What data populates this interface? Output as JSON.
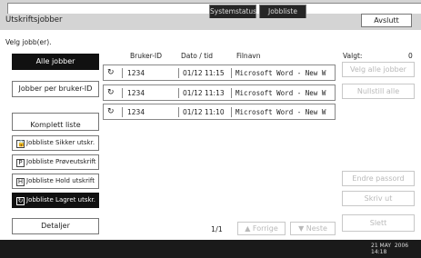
{
  "header": {
    "title": "Utskriftsjobber",
    "exit_label": "Avslutt"
  },
  "prompt": "Velg jobb(er).",
  "left": {
    "all_jobs": "Alle jobber",
    "per_user": "Jobber per bruker-ID",
    "complete_list": "Komplett liste",
    "list_buttons": [
      {
        "icon": "lock-icon",
        "glyph": "🔒",
        "label": "Jobbliste Sikker utskr."
      },
      {
        "icon": "proof-print-icon",
        "glyph": "P",
        "label": "Jobbliste Prøveutskrift"
      },
      {
        "icon": "hold-print-icon",
        "glyph": "H",
        "label": "Jobbliste Hold utskrift"
      },
      {
        "icon": "stored-print-icon",
        "glyph": "↻",
        "label": "Jobbliste Lagret utskr."
      }
    ],
    "details": "Detaljer"
  },
  "table": {
    "columns": [
      "Bruker-ID",
      "Dato / tid",
      "Filnavn"
    ],
    "rows": [
      {
        "user": "1234",
        "datetime": "01/12 11:15",
        "file": "Microsoft Word - New W"
      },
      {
        "user": "1234",
        "datetime": "01/12 11:13",
        "file": "Microsoft Word - New W"
      },
      {
        "user": "1234",
        "datetime": "01/12 11:10",
        "file": "Microsoft Word - New W"
      }
    ]
  },
  "right": {
    "selected_label": "Valgt:",
    "selected_count": "0",
    "select_all": "Velg alle jobber",
    "clear_all": "Nullstill alle",
    "change_password": "Endre passord",
    "print": "Skriv ut",
    "delete": "Slett"
  },
  "pager": {
    "page": "1/1",
    "prev": "▲ Forrige",
    "next": "▼ Neste"
  },
  "bottom": {
    "tab_status": "Systemstatus",
    "tab_joblist": "Jobbliste",
    "clock": "21 MAY  2006\n14:18"
  }
}
